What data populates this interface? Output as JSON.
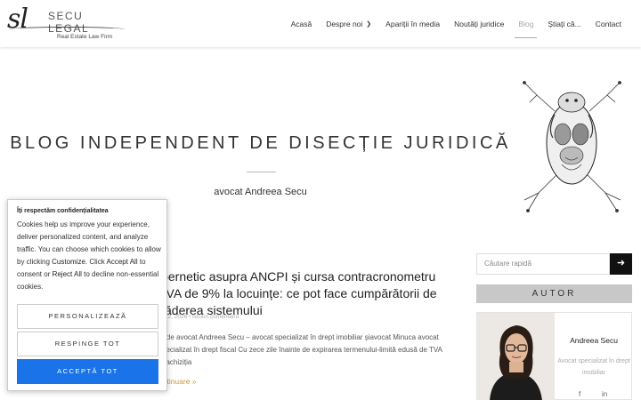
{
  "header": {
    "logo": {
      "monogram": "sl",
      "name": "SECU LEGAL",
      "tagline": "Real Estate Law Firm"
    },
    "nav": [
      {
        "label": "Acasă"
      },
      {
        "label": "Despre noi",
        "has_dropdown": true
      },
      {
        "label": "Apariții în media"
      },
      {
        "label": "Noutăți juridice"
      },
      {
        "label": "Blog",
        "active": true
      },
      {
        "label": "Știați că..."
      },
      {
        "label": "Contact"
      }
    ]
  },
  "hero": {
    "title": "BLOG INDEPENDENT DE DISECȚIE JURIDICĂ",
    "subtitle": "avocat Andreea Secu"
  },
  "post": {
    "title_fragment": "ibernetic asupra ANCPI și cursa contracronometru TVA de 9% la locuințe: ce pot face cumpărătorii de căderea sistemului",
    "meta": "ie 22, 2026 • Niciun comentariu",
    "excerpt": "at de avocat Andreea Secu – avocat specializat în drept imobiliar șiavocat Minuca avocat specializat în drept fiscal Cu zece zile înainte de expirarea termenului-limită edusă de TVA la achiziția",
    "read_more": "ontinuare »"
  },
  "sidebar": {
    "search_placeholder": "Căutare rapidă",
    "search_button": "➜",
    "autor_heading": "AUTOR",
    "author_name": "Andreea Secu",
    "author_desc": "Avocat specializat în drept imobiliar",
    "social": {
      "facebook": "f",
      "linkedin": "in"
    }
  },
  "cookie": {
    "title": "Îți respectăm confidențialitatea",
    "text_1": "Cookies help us improve your experience, deliver personalized content, and analyze traffic. You can choose which cookies to allow by clicking ",
    "link_customize": "Customize",
    "text_2": ". Click ",
    "link_accept": "Accept All",
    "text_3": " to consent or ",
    "link_reject": "Reject All",
    "text_4": " to decline non-essential cookies.",
    "btn_customize": "PERSONALIZEAZĂ",
    "btn_reject": "RESPINGE TOT",
    "btn_accept": "ACCEPTĂ TOT"
  },
  "colors": {
    "accept": "#1a73e8",
    "read_more": "#c49a3a",
    "search_button": "#111111",
    "autor_band": "#c8c8c8"
  }
}
